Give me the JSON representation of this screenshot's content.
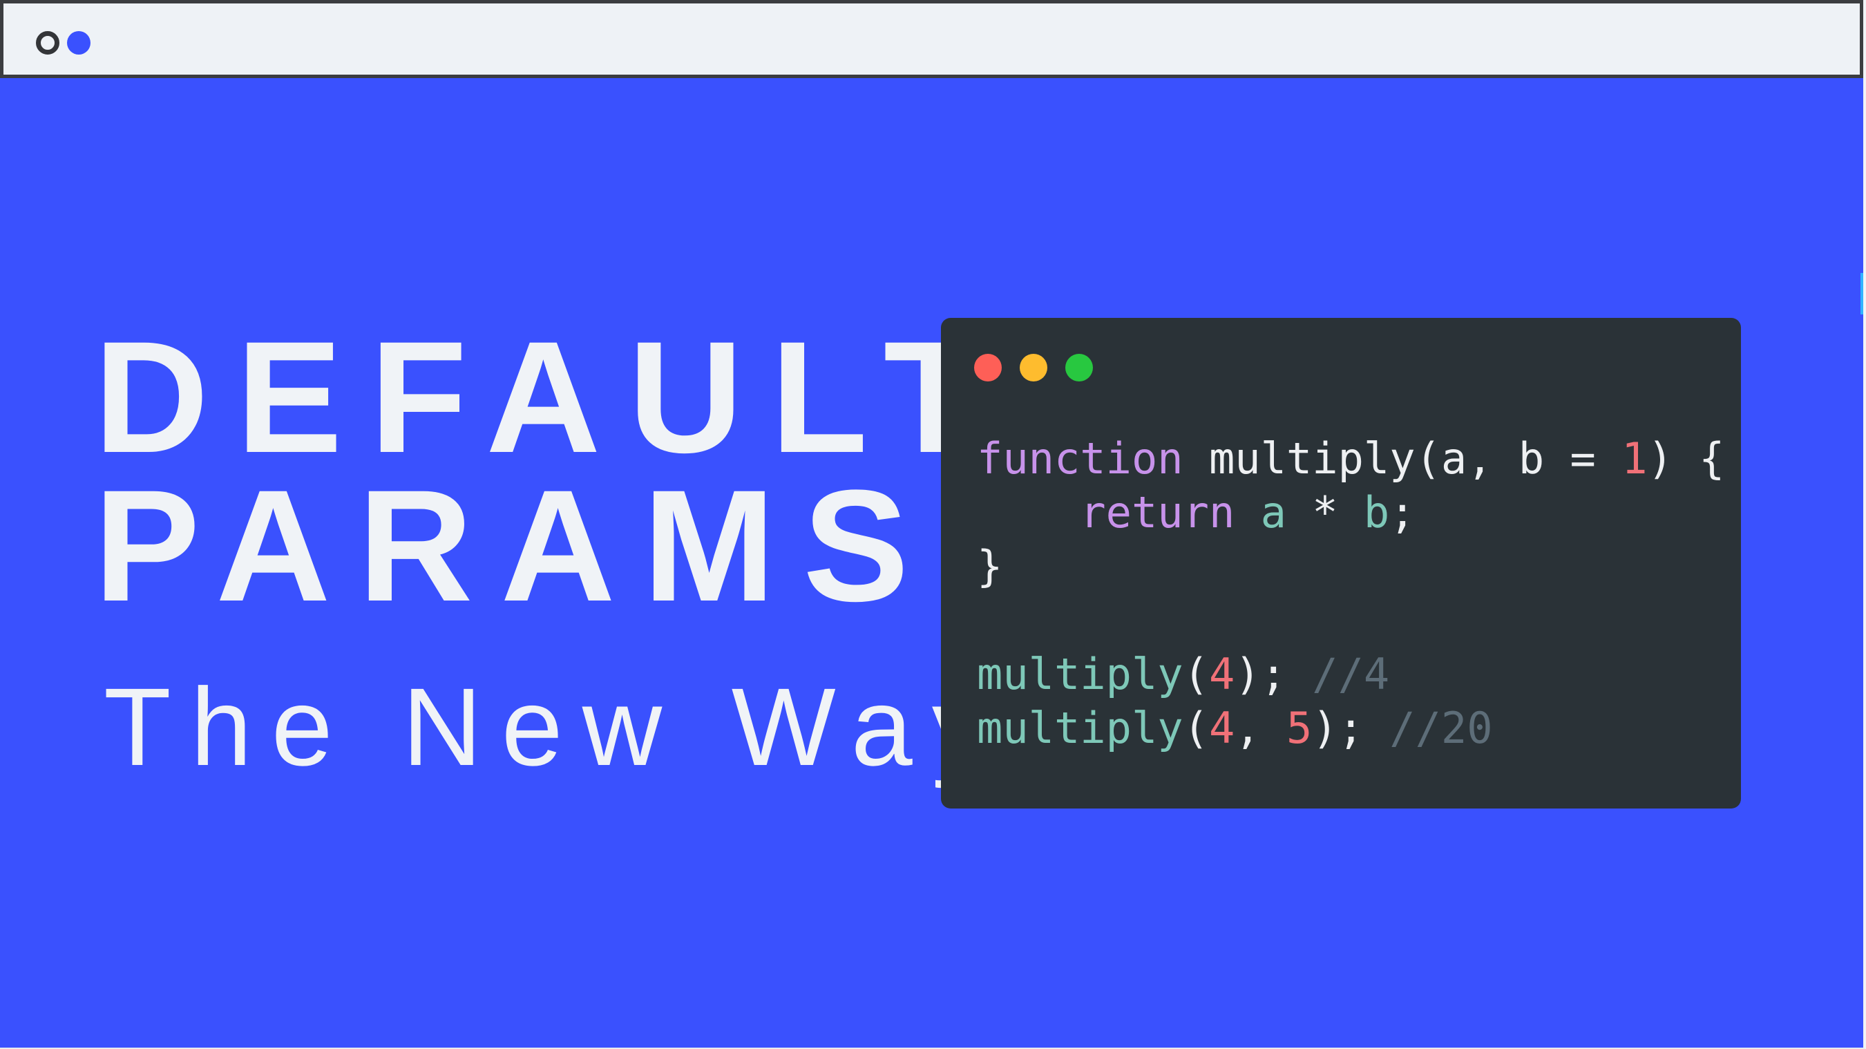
{
  "colors": {
    "background": "#3a51fe",
    "titlebar": "#eef2f6",
    "titlebar_border": "#3b3d40",
    "code_window": "#2a3237",
    "headline_text": "#f0f3f7",
    "keyword": "#c792ea",
    "call": "#7ec8b8",
    "number": "#f07178",
    "comment": "#5d6d78",
    "window_dot_red": "#fe5f57",
    "window_dot_yellow": "#febc2e",
    "window_dot_green": "#28c840"
  },
  "icons": {
    "titlebar_dots": [
      "outline-circle-icon",
      "blue-dot-icon"
    ],
    "window_controls": [
      "close-dot-icon",
      "minimize-dot-icon",
      "zoom-dot-icon"
    ]
  },
  "headline": {
    "line1": "DEFAULT",
    "line2": "PARAMS",
    "subtitle": "The New Way"
  },
  "code": {
    "line1": {
      "keyword": "function",
      "name": " multiply(a, b = ",
      "number": "1",
      "rest": ") {"
    },
    "line2": {
      "indent": "    ",
      "keyword": "return",
      "a": " a",
      "op": " * ",
      "b": "b",
      "semi": ";"
    },
    "line3": "}",
    "line4": {
      "call": "multiply",
      "open": "(",
      "arg1": "4",
      "close": "); ",
      "comment": "//4"
    },
    "line5": {
      "call": "multiply",
      "open": "(",
      "arg1": "4",
      "comma": ", ",
      "arg2": "5",
      "close": "); ",
      "comment": "//20"
    }
  }
}
